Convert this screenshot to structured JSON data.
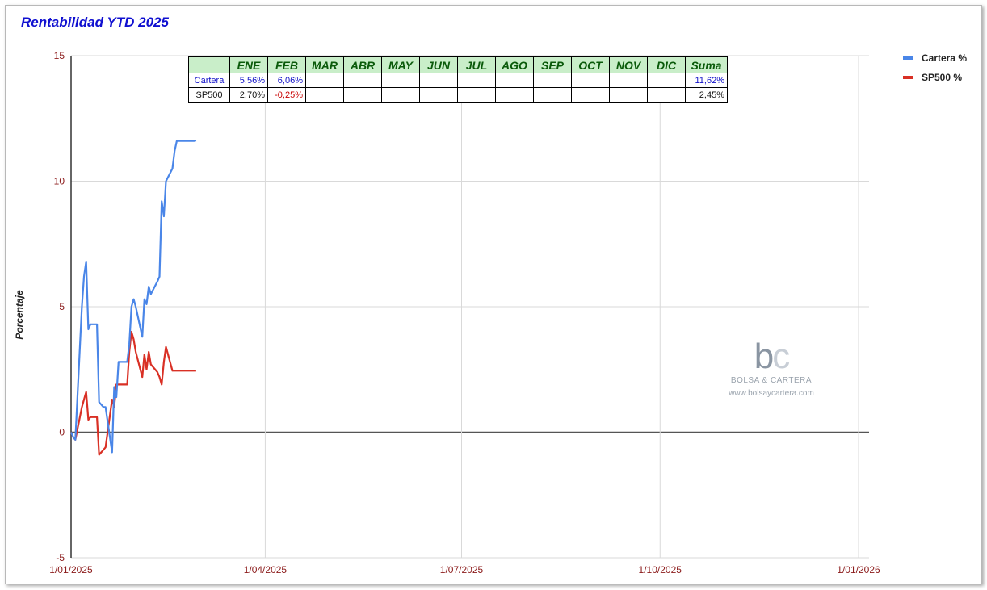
{
  "title": "Rentabilidad YTD 2025",
  "chart_data": {
    "type": "line",
    "title": "Rentabilidad YTD 2025",
    "ylabel": "Porcentaje",
    "xlabel": "",
    "ylim": [
      -5,
      15
    ],
    "yticks": [
      "15",
      "10",
      "5",
      "0",
      "-5"
    ],
    "xlim": [
      "2025-01-01",
      "2026-01-01"
    ],
    "xticks": [
      "1/01/2025",
      "1/04/2025",
      "1/07/2025",
      "1/10/2025",
      "1/01/2026"
    ],
    "grid": true,
    "legend_position": "right",
    "series": [
      {
        "name": "Cartera %",
        "color": "#4a86e8",
        "x": [
          "2025-01-01",
          "2025-01-02",
          "2025-01-03",
          "2025-01-06",
          "2025-01-07",
          "2025-01-08",
          "2025-01-09",
          "2025-01-10",
          "2025-01-13",
          "2025-01-14",
          "2025-01-15",
          "2025-01-16",
          "2025-01-17",
          "2025-01-20",
          "2025-01-21",
          "2025-01-22",
          "2025-01-23",
          "2025-01-24",
          "2025-01-27",
          "2025-01-28",
          "2025-01-29",
          "2025-01-30",
          "2025-01-31",
          "2025-02-03",
          "2025-02-04",
          "2025-02-05",
          "2025-02-06",
          "2025-02-07",
          "2025-02-10",
          "2025-02-11",
          "2025-02-12",
          "2025-02-13",
          "2025-02-14",
          "2025-02-17",
          "2025-02-18",
          "2025-02-19",
          "2025-02-20",
          "2025-02-21",
          "2025-02-24",
          "2025-02-25",
          "2025-02-26",
          "2025-02-27",
          "2025-02-28"
        ],
        "values": [
          0.0,
          -0.2,
          -0.3,
          5.0,
          6.2,
          6.8,
          4.1,
          4.3,
          4.3,
          1.2,
          1.1,
          1.0,
          1.0,
          -0.8,
          1.8,
          1.4,
          2.8,
          2.8,
          2.8,
          3.5,
          5.0,
          5.3,
          5.0,
          3.8,
          5.3,
          5.1,
          5.8,
          5.5,
          6.0,
          6.2,
          9.2,
          8.6,
          10.0,
          10.5,
          11.2,
          11.6,
          11.6,
          11.6,
          11.6,
          11.6,
          11.6,
          11.6,
          11.62
        ]
      },
      {
        "name": "SP500 %",
        "color": "#d93025",
        "x": [
          "2025-01-01",
          "2025-01-02",
          "2025-01-03",
          "2025-01-06",
          "2025-01-07",
          "2025-01-08",
          "2025-01-09",
          "2025-01-10",
          "2025-01-13",
          "2025-01-14",
          "2025-01-15",
          "2025-01-16",
          "2025-01-17",
          "2025-01-20",
          "2025-01-21",
          "2025-01-22",
          "2025-01-23",
          "2025-01-24",
          "2025-01-27",
          "2025-01-28",
          "2025-01-29",
          "2025-01-30",
          "2025-01-31",
          "2025-02-03",
          "2025-02-04",
          "2025-02-05",
          "2025-02-06",
          "2025-02-07",
          "2025-02-10",
          "2025-02-11",
          "2025-02-12",
          "2025-02-13",
          "2025-02-14",
          "2025-02-17",
          "2025-02-18",
          "2025-02-19",
          "2025-02-20",
          "2025-02-21",
          "2025-02-24",
          "2025-02-25",
          "2025-02-26",
          "2025-02-27",
          "2025-02-28"
        ],
        "values": [
          0.0,
          -0.2,
          -0.3,
          1.0,
          1.3,
          1.6,
          0.5,
          0.6,
          0.6,
          -0.9,
          -0.8,
          -0.7,
          -0.6,
          1.3,
          1.0,
          1.9,
          1.9,
          1.9,
          1.9,
          3.2,
          4.0,
          3.7,
          3.2,
          2.2,
          3.1,
          2.5,
          3.2,
          2.7,
          2.4,
          2.2,
          1.9,
          2.8,
          3.4,
          2.45,
          2.45,
          2.45,
          2.45,
          2.45,
          2.45,
          2.45,
          2.45,
          2.45,
          2.45
        ]
      }
    ]
  },
  "legend": [
    {
      "label": "Cartera %",
      "color": "#4a86e8"
    },
    {
      "label": "SP500 %",
      "color": "#d93025"
    }
  ],
  "summary_table": {
    "headers": [
      "ENE",
      "FEB",
      "MAR",
      "ABR",
      "MAY",
      "JUN",
      "JUL",
      "AGO",
      "SEP",
      "OCT",
      "NOV",
      "DIC",
      "Suma"
    ],
    "rows": [
      {
        "label": "Cartera",
        "cells": [
          "5,56%",
          "6,06%",
          "",
          "",
          "",
          "",
          "",
          "",
          "",
          "",
          "",
          "",
          "11,62%"
        ]
      },
      {
        "label": "SP500",
        "cells": [
          "2,70%",
          "-0,25%",
          "",
          "",
          "",
          "",
          "",
          "",
          "",
          "",
          "",
          "",
          "2,45%"
        ]
      }
    ]
  },
  "watermark": {
    "logo_b": "b",
    "logo_c": "c",
    "name": "BOLSA & CARTERA",
    "url": "www.bolsaycartera.com"
  }
}
